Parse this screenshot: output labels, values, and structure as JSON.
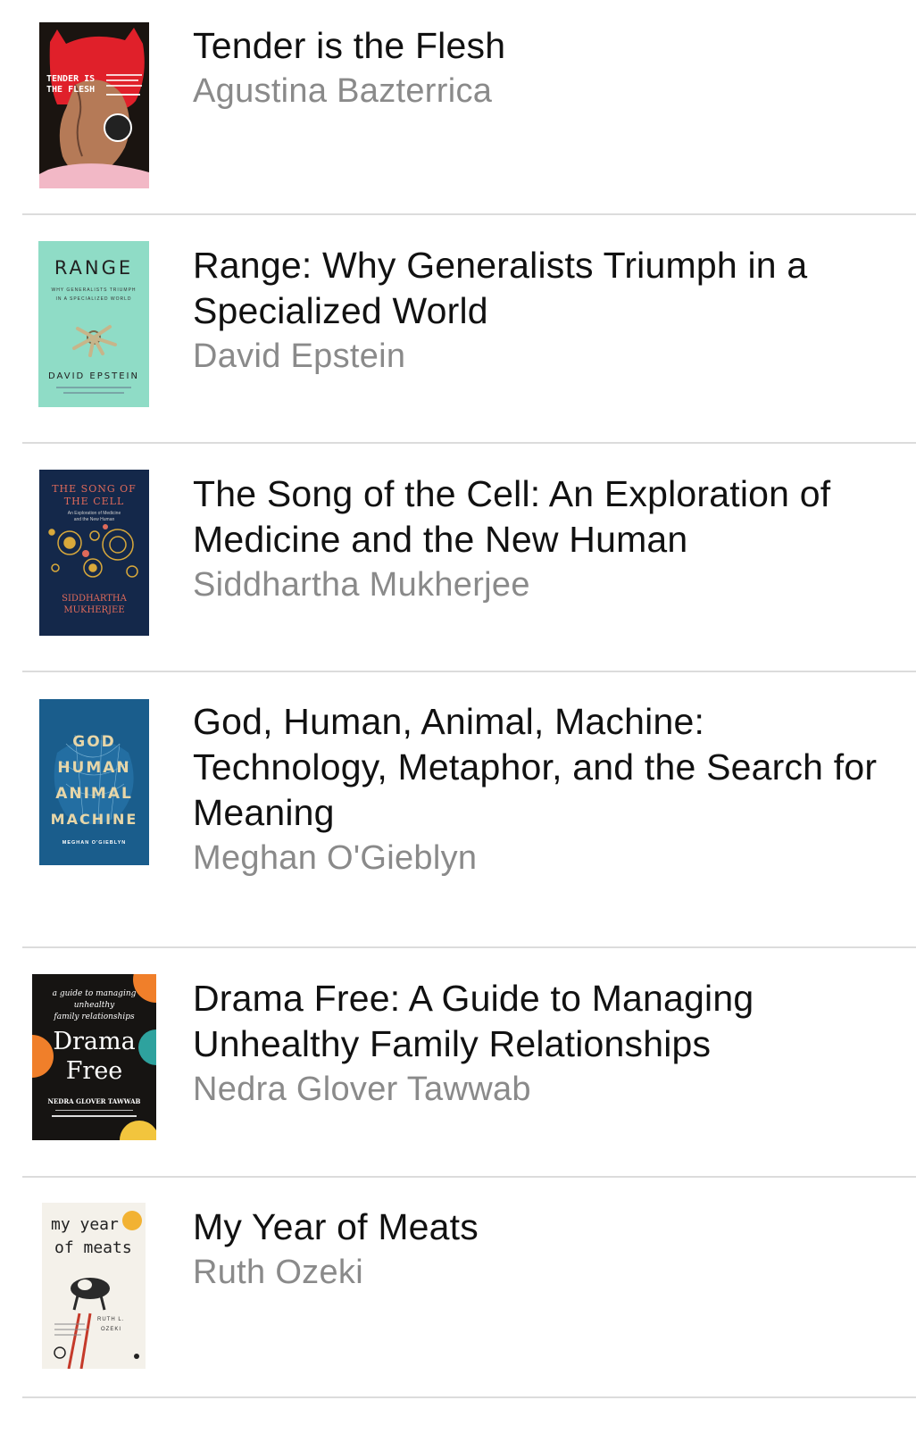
{
  "books": [
    {
      "title": "Tender is the Flesh",
      "author": "Agustina Bazterrica",
      "cover": {
        "text": [
          "TENDER IS",
          "THE FLESH"
        ],
        "colors": {
          "bg": "#1a1410",
          "accent": "#e0202a",
          "skin": "#f2b8c6"
        }
      }
    },
    {
      "title": "Range: Why Generalists Triumph in a Specialized World",
      "author": "David Epstein",
      "cover": {
        "text": [
          "RANGE",
          "WHY GENERALISTS TRIUMPH",
          "IN A SPECIALIZED WORLD",
          "DAVID EPSTEIN"
        ],
        "colors": {
          "bg": "#8fdcc6"
        }
      }
    },
    {
      "title": "The Song of the Cell: An Exploration of Medicine and the New Human",
      "author": "Siddhartha Mukherjee",
      "cover": {
        "text": [
          "THE SONG OF",
          "THE CELL",
          "An Exploration of Medicine",
          "and the New Human",
          "SIDDHARTHA",
          "MUKHERJEE"
        ],
        "colors": {
          "bg": "#14284a",
          "accent": "#d9a93b",
          "red": "#e06a5a"
        }
      }
    },
    {
      "title": "God, Human, Animal, Machine: Technology, Metaphor, and the Search for Meaning",
      "author": "Meghan O'Gieblyn",
      "cover": {
        "text": [
          "GOD",
          "HUMAN",
          "ANIMAL",
          "MACHINE",
          "MEGHAN O'GIEBLYN"
        ],
        "colors": {
          "bg": "#1a5d8c",
          "accent": "#e7d6a8"
        }
      }
    },
    {
      "title": "Drama Free: A Guide to Managing Unhealthy Family Relationships",
      "author": "Nedra Glover Tawwab",
      "cover": {
        "text": [
          "a guide to managing",
          "unhealthy",
          "family relationships",
          "Drama",
          "Free",
          "NEDRA GLOVER TAWWAB"
        ],
        "colors": {
          "bg": "#161412",
          "orange": "#f07f2a",
          "teal": "#2ea29e",
          "yellow": "#f2c53d"
        }
      }
    },
    {
      "title": "My Year of Meats",
      "author": "Ruth Ozeki",
      "cover": {
        "text": [
          "my year",
          "of meats",
          "RUTH L.",
          "OZEKI"
        ],
        "colors": {
          "bg": "#f4f1ea",
          "accent": "#c53a2a",
          "gold": "#f2b233"
        }
      }
    }
  ]
}
